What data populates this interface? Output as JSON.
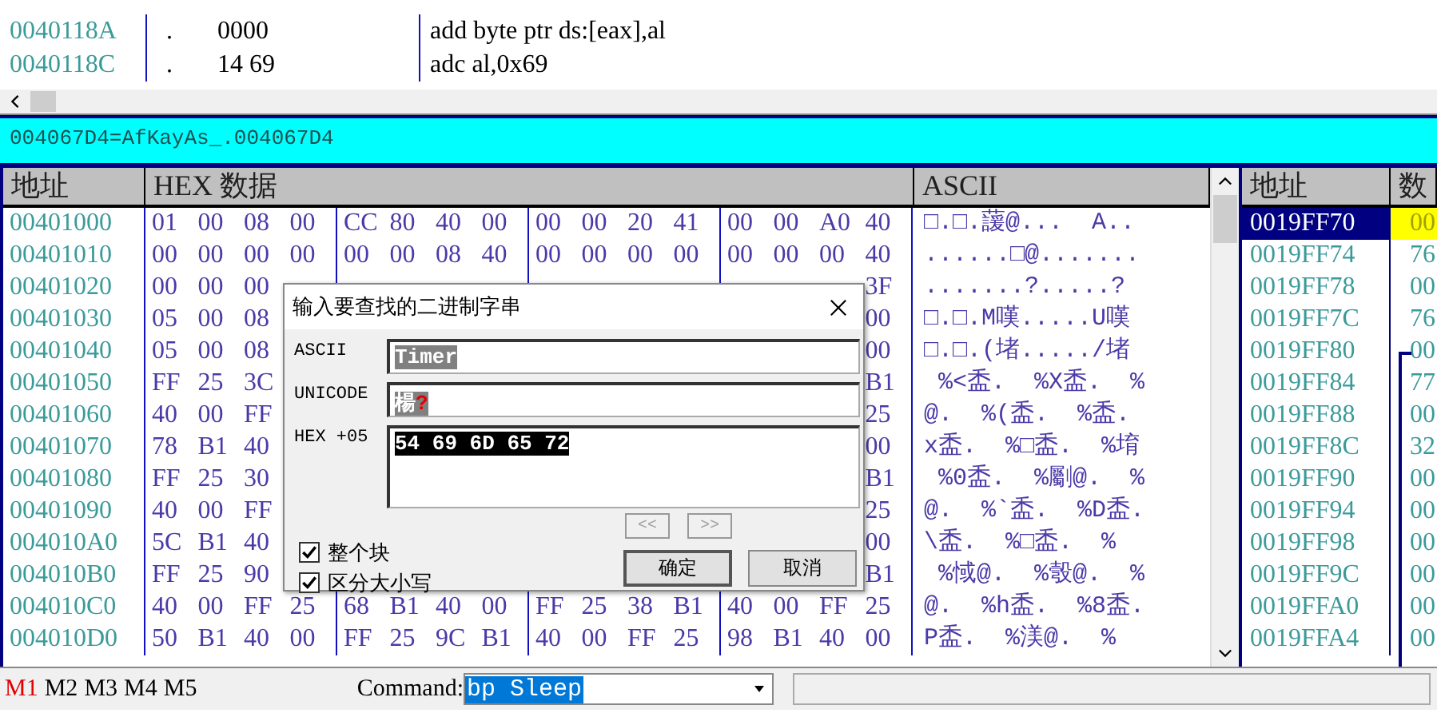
{
  "disassembly": {
    "rows": [
      {
        "address": "0040118A",
        "marker": ".",
        "bytes": "0000",
        "instruction": "add byte ptr ds:[eax],al"
      },
      {
        "address": "0040118C",
        "marker": ".",
        "bytes": "14 69",
        "instruction": "adc al,0x69"
      }
    ]
  },
  "info_line": "004067D4=AfKayAs_.004067D4",
  "dump": {
    "columns": [
      "地址",
      "HEX 数据",
      "ASCII"
    ],
    "rows": [
      {
        "address": "00401000",
        "bytes": [
          "01",
          "00",
          "08",
          "00",
          "CC",
          "80",
          "40",
          "00",
          "00",
          "00",
          "20",
          "41",
          "00",
          "00",
          "A0",
          "40"
        ],
        "ascii": "□.□.蘐@...  A.."
      },
      {
        "address": "00401010",
        "bytes": [
          "00",
          "00",
          "00",
          "00",
          "00",
          "00",
          "08",
          "40",
          "00",
          "00",
          "00",
          "00",
          "00",
          "00",
          "00",
          "40"
        ],
        "ascii": "......□@......."
      },
      {
        "address": "00401020",
        "bytes": [
          "00",
          "00",
          "00"
        ],
        "tail_bytes": [
          "3F"
        ],
        "ascii": ".......?.....?"
      },
      {
        "address": "00401030",
        "bytes": [
          "05",
          "00",
          "08"
        ],
        "tail_bytes": [
          "00"
        ],
        "ascii": "□.□.M嘆.....U嘆"
      },
      {
        "address": "00401040",
        "bytes": [
          "05",
          "00",
          "08"
        ],
        "tail_bytes": [
          "00"
        ],
        "ascii": "□.□.(堵...../堵"
      },
      {
        "address": "00401050",
        "bytes": [
          "FF",
          "25",
          "3C"
        ],
        "tail_bytes": [
          "B1"
        ],
        "ascii": " %<盉.  %X盉.  %"
      },
      {
        "address": "00401060",
        "bytes": [
          "40",
          "00",
          "FF"
        ],
        "tail_bytes": [
          "25"
        ],
        "ascii": "@.  %(盉.  %盉."
      },
      {
        "address": "00401070",
        "bytes": [
          "78",
          "B1",
          "40"
        ],
        "tail_bytes": [
          "00"
        ],
        "ascii": "x盉.  %□盉.  %堉"
      },
      {
        "address": "00401080",
        "bytes": [
          "FF",
          "25",
          "30"
        ],
        "tail_bytes": [
          "B1"
        ],
        "ascii": " %0盉.  %劚@.  %"
      },
      {
        "address": "00401090",
        "bytes": [
          "40",
          "00",
          "FF"
        ],
        "tail_bytes": [
          "25"
        ],
        "ascii": "@.  %`盉.  %D盉."
      },
      {
        "address": "004010A0",
        "bytes": [
          "5C",
          "B1",
          "40"
        ],
        "tail_bytes": [
          "00"
        ],
        "ascii": "\\盉.  %□盉.  %"
      },
      {
        "address": "004010B0",
        "bytes": [
          "FF",
          "25",
          "90"
        ],
        "tail_bytes": [
          "B1"
        ],
        "ascii": " %惐@.  %彀@.  %"
      },
      {
        "address": "004010C0",
        "bytes": [
          "40",
          "00",
          "FF",
          "25",
          "68",
          "B1",
          "40",
          "00",
          "FF",
          "25",
          "38",
          "B1",
          "40",
          "00",
          "FF",
          "25"
        ],
        "ascii": "@.  %h盉.  %8盉."
      },
      {
        "address": "004010D0",
        "bytes": [
          "50",
          "B1",
          "40",
          "00",
          "FF",
          "25",
          "9C",
          "B1",
          "40",
          "00",
          "FF",
          "25",
          "98",
          "B1",
          "40",
          "00"
        ],
        "ascii": "P盉.  %渼@.  %"
      }
    ]
  },
  "stack": {
    "columns": [
      "地址",
      "数"
    ],
    "rows": [
      {
        "address": "0019FF70",
        "value": "00",
        "selected": true
      },
      {
        "address": "0019FF74",
        "value": "76",
        "selected": false
      },
      {
        "address": "0019FF78",
        "value": "00",
        "selected": false
      },
      {
        "address": "0019FF7C",
        "value": "76",
        "selected": false
      },
      {
        "address": "0019FF80",
        "value": "00",
        "selected": false
      },
      {
        "address": "0019FF84",
        "value": "77",
        "selected": false
      },
      {
        "address": "0019FF88",
        "value": "00",
        "selected": false
      },
      {
        "address": "0019FF8C",
        "value": "32",
        "selected": false
      },
      {
        "address": "0019FF90",
        "value": "00",
        "selected": false
      },
      {
        "address": "0019FF94",
        "value": "00",
        "selected": false
      },
      {
        "address": "0019FF98",
        "value": "00",
        "selected": false
      },
      {
        "address": "0019FF9C",
        "value": "00",
        "selected": false
      },
      {
        "address": "0019FFA0",
        "value": "00",
        "selected": false
      },
      {
        "address": "0019FFA4",
        "value": "00",
        "selected": false
      }
    ]
  },
  "dialog": {
    "title": "输入要查找的二进制字串",
    "ascii": {
      "label": "ASCII",
      "value": "Timer"
    },
    "unicode": {
      "label": "UNICODE",
      "value": "楊",
      "unknown_mark": "?"
    },
    "hex": {
      "label": "HEX +05",
      "value": "54 69 6D 65 72"
    },
    "nav_buttons": [
      {
        "label": "<<",
        "disabled": true
      },
      {
        "label": ">>",
        "disabled": true
      }
    ],
    "options": [
      {
        "label": "整个块",
        "checked": true
      },
      {
        "label": "区分大小写",
        "checked": true
      }
    ],
    "buttons": [
      "确定",
      "取消"
    ]
  },
  "bottom_bar": {
    "memory_tabs": [
      {
        "label": "M1",
        "selected": true
      },
      {
        "label": "M2",
        "selected": false
      },
      {
        "label": "M3",
        "selected": false
      },
      {
        "label": "M4",
        "selected": false
      },
      {
        "label": "M5",
        "selected": false
      }
    ],
    "command_label": "Command:",
    "command_value": "bp Sleep"
  }
}
